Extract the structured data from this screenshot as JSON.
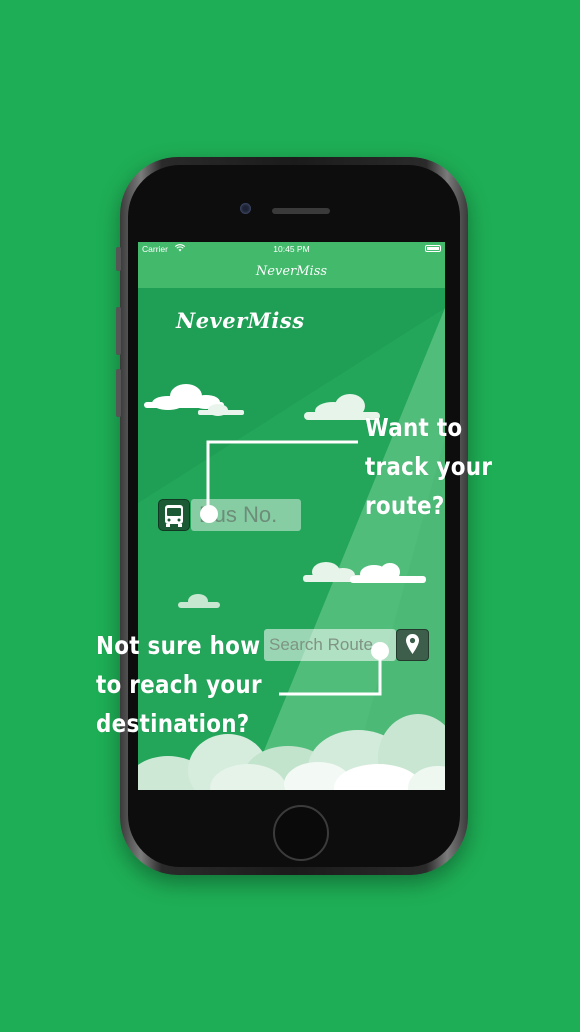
{
  "status_bar": {
    "carrier": "Carrier",
    "time": "10:45 PM"
  },
  "nav_bar": {
    "title": "NeverMiss"
  },
  "app": {
    "logo": "NeverMiss",
    "bus_input": {
      "placeholder": "Bus No.",
      "value": ""
    },
    "route_input": {
      "placeholder": "Search Route",
      "value": ""
    }
  },
  "callouts": {
    "track": [
      "Want to",
      "track your",
      "route?"
    ],
    "destination": [
      "Not sure how",
      "to reach your",
      "destination?"
    ]
  },
  "colors": {
    "background": "#1eae55",
    "header": "#42b96b",
    "screen": "#23a55a",
    "callout_text": "#ffffff"
  },
  "icons": {
    "bus": "bus-icon",
    "map_pin": "map-pin-icon",
    "wifi": "wifi-icon",
    "battery": "battery-icon"
  }
}
